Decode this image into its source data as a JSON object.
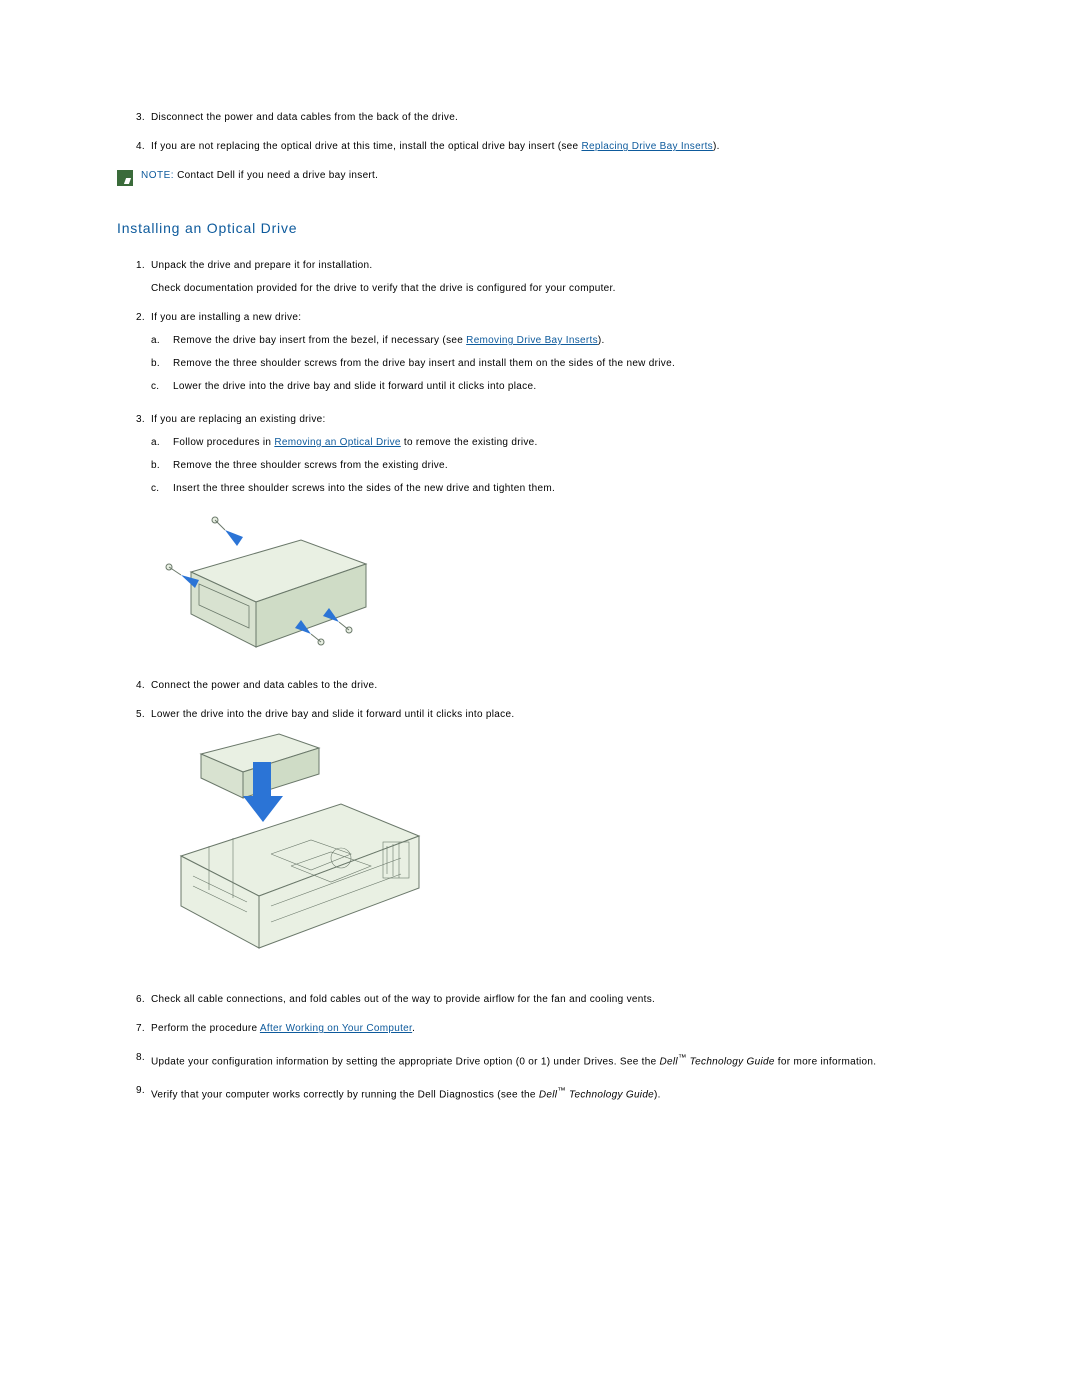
{
  "pre_steps": {
    "s3": {
      "num": "3.",
      "text": "Disconnect the power and data cables from the back of the drive."
    },
    "s4": {
      "num": "4.",
      "text_a": "If you are not replacing the optical drive at this time, install the optical drive bay insert (see ",
      "link": "Replacing Drive Bay Inserts",
      "text_b": ")."
    }
  },
  "note": {
    "label": "NOTE:",
    "text": " Contact Dell if you need a drive bay insert."
  },
  "section_title": "Installing an Optical Drive",
  "steps": {
    "s1": {
      "num": "1.",
      "text": "Unpack the drive and prepare it for installation.",
      "sub": "Check documentation provided for the drive to verify that the drive is configured for your computer."
    },
    "s2": {
      "num": "2.",
      "text": "If you are installing a new drive:",
      "a": {
        "l": "a.",
        "t1": "Remove the drive bay insert from the bezel, if necessary (see ",
        "link": "Removing Drive Bay Inserts",
        "t2": ")."
      },
      "b": {
        "l": "b.",
        "t": "Remove the three shoulder screws from the drive bay insert and install them on the sides of the new drive."
      },
      "c": {
        "l": "c.",
        "t": "Lower the drive into the drive bay and slide it forward until it clicks into place."
      }
    },
    "s3": {
      "num": "3.",
      "text": "If you are replacing an existing drive:",
      "a": {
        "l": "a.",
        "t1": "Follow procedures in ",
        "link": "Removing an Optical Drive",
        "t2": " to remove the existing drive."
      },
      "b": {
        "l": "b.",
        "t": "Remove the three shoulder screws from the existing drive."
      },
      "c": {
        "l": "c.",
        "t": "Insert the three shoulder screws into the sides of the new drive and tighten them."
      }
    },
    "s4": {
      "num": "4.",
      "text": "Connect the power and data cables to the drive."
    },
    "s5": {
      "num": "5.",
      "text": "Lower the drive into the drive bay and slide it forward until it clicks into place."
    },
    "s6": {
      "num": "6.",
      "text": "Check all cable connections, and fold cables out of the way to provide airflow for the fan and cooling vents."
    },
    "s7": {
      "num": "7.",
      "t1": "Perform the procedure ",
      "link": "After Working on Your Computer",
      "t2": "."
    },
    "s8": {
      "num": "8.",
      "t1": "Update your configuration information by setting the appropriate Drive option (0 or 1) under Drives. See the ",
      "it1": "Dell",
      "tm": "™",
      "it2": " Technology Guide",
      "t2": " for more information."
    },
    "s9": {
      "num": "9.",
      "t1": "Verify that your computer works correctly by running the Dell Diagnostics (see the ",
      "it1": "Dell",
      "tm": "™",
      "it2": " Technology Guide",
      "t2": ")."
    }
  }
}
